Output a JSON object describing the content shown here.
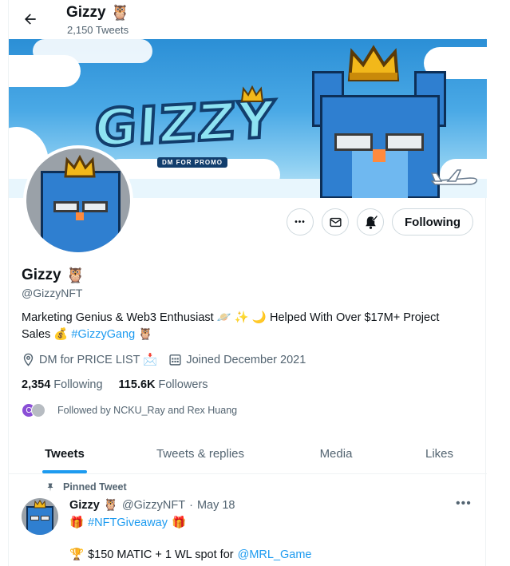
{
  "header": {
    "title": "Gizzy",
    "title_emoji": "🦉",
    "tweet_count": "2,150 Tweets"
  },
  "banner": {
    "logo_text": "GIZZY",
    "logo_tag": "DM FOR PROMO"
  },
  "actions": {
    "more_label": "•••",
    "follow_label": "Following"
  },
  "profile": {
    "name": "Gizzy",
    "name_emoji": "🦉",
    "handle": "@GizzyNFT",
    "bio_text": "Marketing Genius & Web3 Enthusiast 🪐 ✨ 🌙 Helped With Over $17M+ Project Sales 💰",
    "bio_hashtag": "#GizzyGang",
    "bio_end_emoji": "🦉",
    "location": "DM for PRICE LIST 📩",
    "joined": "Joined December 2021"
  },
  "stats": {
    "following_count": "2,354",
    "following_label": "Following",
    "followers_count": "115.6K",
    "followers_label": "Followers"
  },
  "followed_by": "Followed by NCKU_Ray and Rex Huang",
  "tabs": [
    {
      "label": "Tweets"
    },
    {
      "label": "Tweets & replies"
    },
    {
      "label": "Media"
    },
    {
      "label": "Likes"
    }
  ],
  "tweet": {
    "pinned_label": "Pinned Tweet",
    "author": "Gizzy",
    "author_emoji": "🦉",
    "handle": "@GizzyNFT",
    "separator": "·",
    "date": "May 18",
    "more_label": "•••",
    "line1_emoji_left": "🎁",
    "line1_hashtag": "#NFTGiveaway",
    "line1_emoji_right": "🎁",
    "line2_emoji": "🏆",
    "line2_text": "$150 MATIC + 1 WL spot for",
    "line2_mention": "@MRL_Game"
  },
  "colors": {
    "accent": "#1d9bf0",
    "text": "#0f1419",
    "muted": "#536471",
    "border": "#cfd9de"
  }
}
